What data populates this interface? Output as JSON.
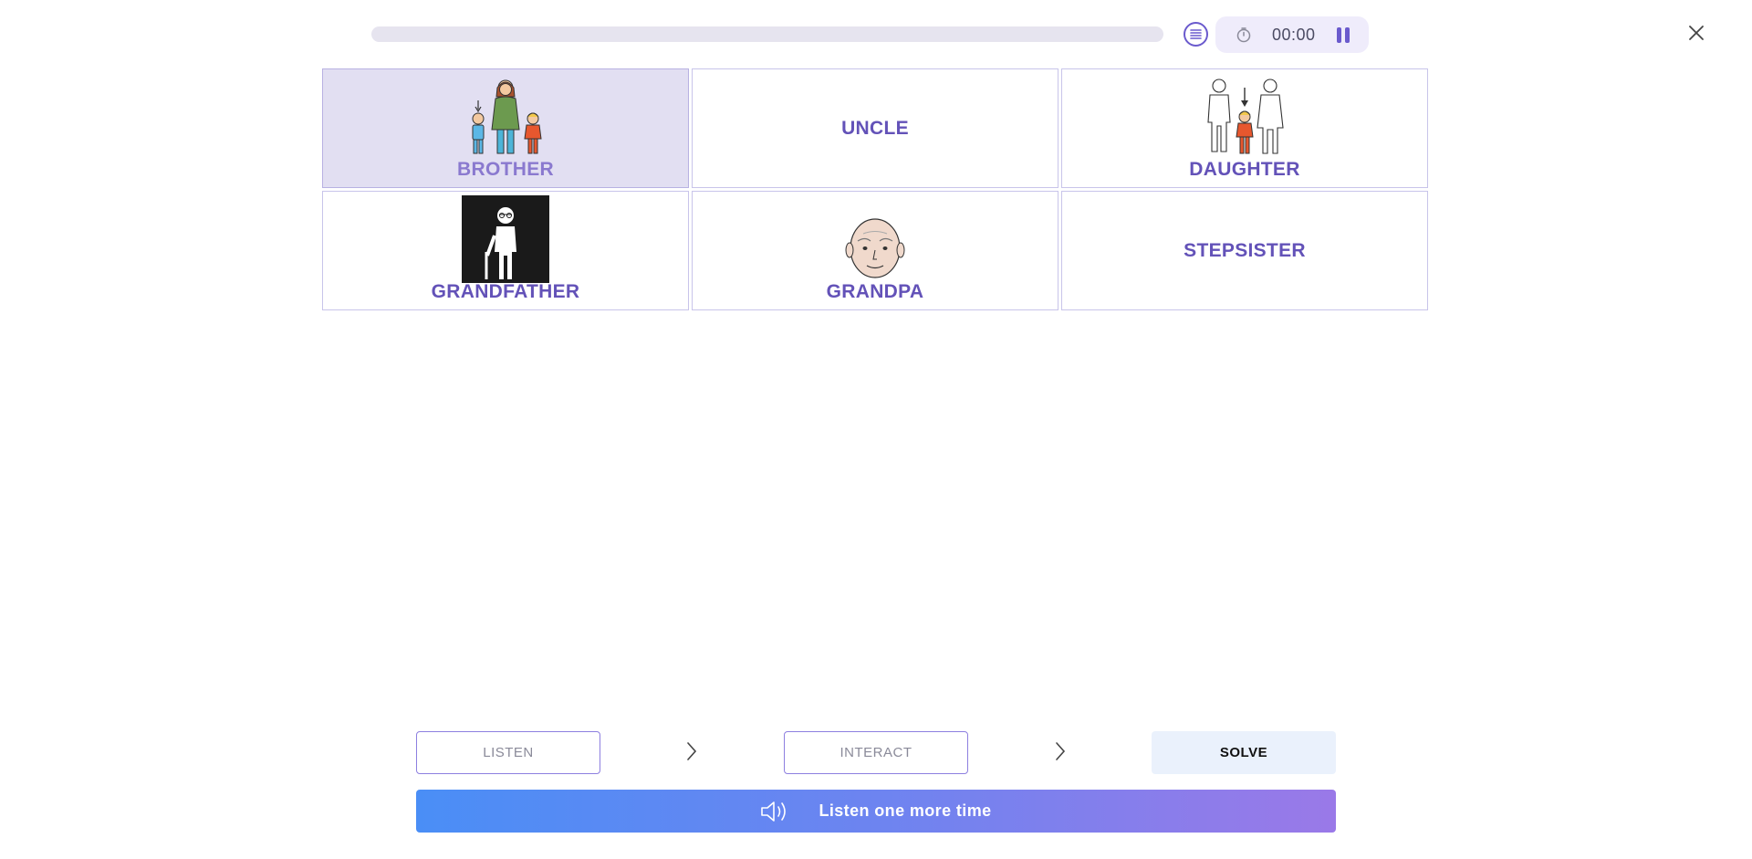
{
  "progress": {
    "fraction": 0.0
  },
  "timer": {
    "value": "00:00"
  },
  "cards": [
    {
      "word": "BROTHER",
      "picture": "family-mother-children-icon",
      "selected": true
    },
    {
      "word": "UNCLE",
      "picture": null,
      "selected": false
    },
    {
      "word": "DAUGHTER",
      "picture": "parents-daughter-icon",
      "selected": false
    },
    {
      "word": "GRANDFATHER",
      "picture": "old-man-cane-icon",
      "selected": false
    },
    {
      "word": "GRANDPA",
      "picture": "old-man-face-icon",
      "selected": false
    },
    {
      "word": "STEPSISTER",
      "picture": null,
      "selected": false
    }
  ],
  "steps": {
    "listen_label": "LISTEN",
    "interact_label": "INTERACT",
    "solve_label": "SOLVE"
  },
  "listen_bar": {
    "label": "Listen one more time"
  },
  "colors": {
    "accent": "#6352b8",
    "selected_bg": "#e2dff2",
    "gradient_start": "#4a8ef6",
    "gradient_end": "#9a79e8"
  }
}
